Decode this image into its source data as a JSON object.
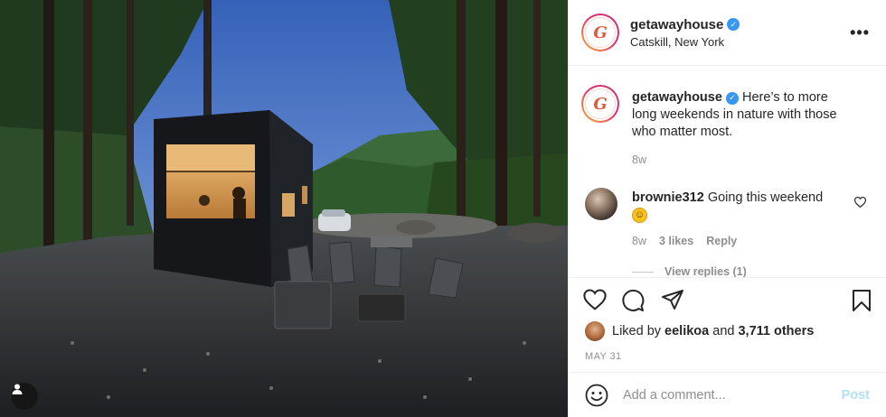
{
  "post": {
    "username": "getawayhouse",
    "location": "Catskill, New York",
    "avatar_letter": "G",
    "more_label": "•••"
  },
  "caption": {
    "username": "getawayhouse",
    "text": "Here’s to more long weekends in nature with those who matter most.",
    "time": "8w"
  },
  "comment": {
    "username": "brownie312",
    "text": "Going this weekend",
    "emoji": "☺",
    "time": "8w",
    "likes": "3 likes",
    "reply_label": "Reply",
    "view_replies": "View replies (1)"
  },
  "likes": {
    "prefix": "Liked by",
    "user": "eelikoa",
    "middle": "and",
    "others": "3,711 others"
  },
  "date": "MAY 31",
  "add_comment": {
    "placeholder": "Add a comment...",
    "post_label": "Post"
  },
  "colors": {
    "verified": "#3897f0",
    "post_disabled": "#b2dffc",
    "brand_accent": "#e1583b"
  },
  "icons": [
    "user-tag-icon",
    "verified-icon",
    "more-icon",
    "heart-icon",
    "comment-icon",
    "share-icon",
    "bookmark-icon",
    "emoji-icon"
  ]
}
